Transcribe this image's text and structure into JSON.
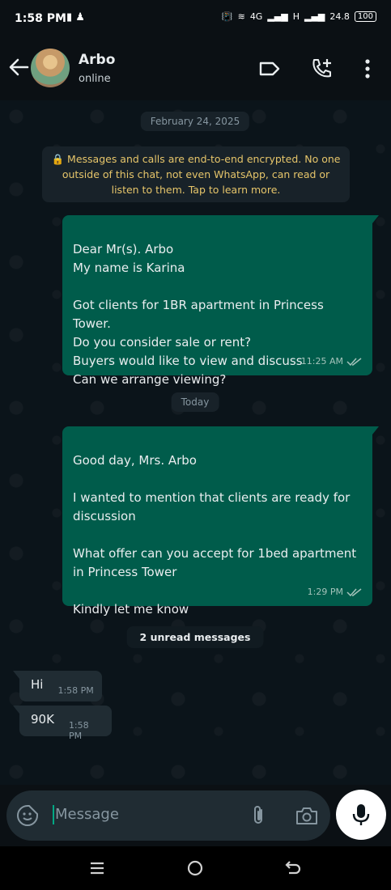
{
  "status_bar": {
    "time": "1:58 PM",
    "network_4g": "4G",
    "network_h": "H",
    "data_speed": "24.8",
    "battery": "100"
  },
  "header": {
    "contact_name": "Arbo",
    "contact_status": "online",
    "icons": [
      "back-arrow-icon",
      "label-icon",
      "add-call-icon",
      "more-vert-icon"
    ]
  },
  "chat": {
    "date_first": "February 24, 2025",
    "encryption_notice": "🔒 Messages and calls are end-to-end encrypted. No one outside of this chat, not even WhatsApp, can read or listen to them. Tap to learn more.",
    "message_1": {
      "text": "Dear Mr(s). Arbo\nMy name is Karina\n\nGot clients for 1BR apartment in Princess Tower.\nDo you consider sale or rent?\nBuyers would like to view and discuss\nCan we arrange viewing?",
      "time": "11:25 AM"
    },
    "date_second": "Today",
    "message_2": {
      "text": "Good day, Mrs. Arbo\n\nI wanted to mention that clients are ready for discussion\n\nWhat offer can you accept for 1bed apartment in Princess Tower\n\nKindly let me know",
      "time": "1:29 PM"
    },
    "unread_divider": "2 unread messages",
    "incoming": [
      {
        "text": "Hi",
        "time": "1:58 PM"
      },
      {
        "text": "90K",
        "time": "1:58 PM"
      }
    ]
  },
  "input": {
    "placeholder": "Message"
  },
  "colors": {
    "outgoing_bubble": "#005c4b",
    "incoming_bubble": "#202c33",
    "accent": "#00a884",
    "encryption_text": "#e6c56a"
  }
}
